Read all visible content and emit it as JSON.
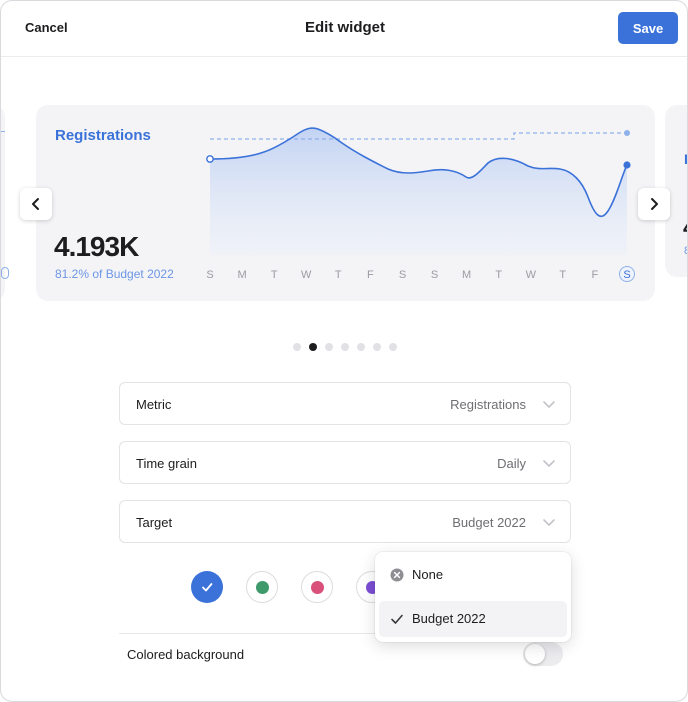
{
  "header": {
    "cancel_label": "Cancel",
    "title": "Edit widget",
    "save_label": "Save"
  },
  "widget": {
    "metric_label": "Registrations",
    "big_value": "4.193K",
    "sub_value": "81.2% of Budget 2022",
    "day_labels": [
      "S",
      "M",
      "T",
      "W",
      "T",
      "F",
      "S",
      "S",
      "M",
      "T",
      "W",
      "T",
      "F",
      "S"
    ],
    "highlighted_day_index": 13
  },
  "peek_right": {
    "title": "R",
    "big": "4",
    "sub": "8"
  },
  "carousel": {
    "dot_count": 7,
    "active_index": 1
  },
  "fields": [
    {
      "label": "Metric",
      "value": "Registrations"
    },
    {
      "label": "Time grain",
      "value": "Daily"
    },
    {
      "label": "Target",
      "value": "Budget 2022"
    }
  ],
  "colors": {
    "accent": "#3b72d9",
    "swatches": [
      "#3b72d9",
      "#3e9a6b",
      "#d9507a",
      "#7b4fd4"
    ],
    "selected_swatch_index": 0
  },
  "background_toggle": {
    "label": "Colored background",
    "on": false
  },
  "dropdown": {
    "options": [
      {
        "label": "None",
        "icon": "clear-circle-icon"
      },
      {
        "label": "Budget 2022",
        "icon": "check-icon"
      }
    ],
    "selected_index": 1
  }
}
